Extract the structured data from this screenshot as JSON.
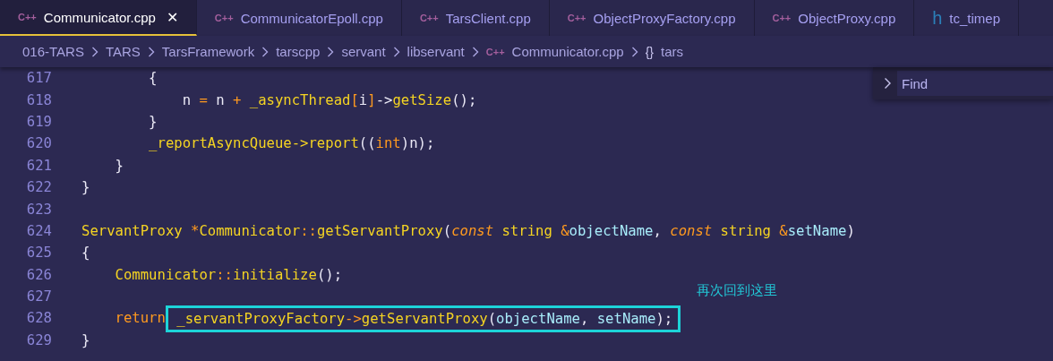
{
  "tabs": [
    {
      "icon": "C++",
      "kind": "cpp",
      "label": "Communicator.cpp",
      "selected": true,
      "closable": true
    },
    {
      "icon": "C++",
      "kind": "cpp",
      "label": "CommunicatorEpoll.cpp",
      "selected": false,
      "closable": false
    },
    {
      "icon": "C++",
      "kind": "cpp",
      "label": "TarsClient.cpp",
      "selected": false,
      "closable": false
    },
    {
      "icon": "C++",
      "kind": "cpp",
      "label": "ObjectProxyFactory.cpp",
      "selected": false,
      "closable": false
    },
    {
      "icon": "C++",
      "kind": "cpp",
      "label": "ObjectProxy.cpp",
      "selected": false,
      "closable": false
    },
    {
      "icon": "h",
      "kind": "header",
      "label": "tc_timep",
      "selected": false,
      "closable": false
    }
  ],
  "close_glyph": "✕",
  "breadcrumb": [
    {
      "label": "016-TARS"
    },
    {
      "label": "TARS"
    },
    {
      "label": "TarsFramework"
    },
    {
      "label": "tarscpp"
    },
    {
      "label": "servant"
    },
    {
      "label": "libservant"
    },
    {
      "label": "Communicator.cpp",
      "icon": "C++",
      "kind": "cpp"
    },
    {
      "label": "tars",
      "icon": "{}",
      "kind": "namespace"
    }
  ],
  "find": {
    "placeholder": "Find"
  },
  "code": [
    {
      "num": "617",
      "tokens": [
        {
          "t": "        {",
          "kind": "plain"
        }
      ]
    },
    {
      "num": "618",
      "tokens": [
        {
          "t": "            n ",
          "kind": "plain"
        },
        {
          "t": "=",
          "kind": "op"
        },
        {
          "t": " n ",
          "kind": "plain"
        },
        {
          "t": "+",
          "kind": "op"
        },
        {
          "t": " _asyncThread",
          "kind": "name"
        },
        {
          "t": "[",
          "kind": "op"
        },
        {
          "t": "i",
          "kind": "plain"
        },
        {
          "t": "]",
          "kind": "op"
        },
        {
          "t": "->",
          "kind": "plain"
        },
        {
          "t": "getSize",
          "kind": "name"
        },
        {
          "t": "();",
          "kind": "plain"
        }
      ]
    },
    {
      "num": "619",
      "tokens": [
        {
          "t": "        }",
          "kind": "plain"
        }
      ]
    },
    {
      "num": "620",
      "tokens": [
        {
          "t": "        _reportAsyncQueue->report",
          "kind": "name"
        },
        {
          "t": "((",
          "kind": "plain"
        },
        {
          "t": "int",
          "kind": "op"
        },
        {
          "t": ")n);",
          "kind": "plain"
        }
      ]
    },
    {
      "num": "621",
      "tokens": [
        {
          "t": "    }",
          "kind": "plain"
        }
      ]
    },
    {
      "num": "622",
      "tokens": [
        {
          "t": "}",
          "kind": "plain"
        }
      ]
    },
    {
      "num": "623"
    },
    {
      "num": "624",
      "tokens": [
        {
          "t": "ServantProxy ",
          "kind": "name"
        },
        {
          "t": "*",
          "kind": "op"
        },
        {
          "t": "Communicator",
          "kind": "name"
        },
        {
          "t": "::",
          "kind": "op"
        },
        {
          "t": "getServantProxy",
          "kind": "name"
        },
        {
          "t": "(",
          "kind": "plain"
        },
        {
          "t": "const",
          "kind": "italic"
        },
        {
          "t": " string ",
          "kind": "name"
        },
        {
          "t": "&",
          "kind": "op"
        },
        {
          "t": "objectName",
          "kind": "param"
        },
        {
          "t": ", ",
          "kind": "plain"
        },
        {
          "t": "const",
          "kind": "italic"
        },
        {
          "t": " string ",
          "kind": "name"
        },
        {
          "t": "&",
          "kind": "op"
        },
        {
          "t": "setName",
          "kind": "param"
        },
        {
          "t": ")",
          "kind": "plain"
        }
      ]
    },
    {
      "num": "625",
      "tokens": [
        {
          "t": "{",
          "kind": "plain"
        }
      ]
    },
    {
      "num": "626",
      "tokens": [
        {
          "t": "    Communicator",
          "kind": "name"
        },
        {
          "t": "::",
          "kind": "op"
        },
        {
          "t": "initialize",
          "kind": "name"
        },
        {
          "t": "();",
          "kind": "plain"
        }
      ]
    },
    {
      "num": "627"
    },
    {
      "num": "628",
      "tokens": [
        {
          "t": "    return",
          "kind": "op"
        }
      ],
      "boxed": [
        {
          "t": " _servantProxyFactory",
          "kind": "name"
        },
        {
          "t": "->",
          "kind": "op"
        },
        {
          "t": "getServantProxy",
          "kind": "name"
        },
        {
          "t": "(",
          "kind": "plain"
        },
        {
          "t": "objectName",
          "kind": "param"
        },
        {
          "t": ", ",
          "kind": "plain"
        },
        {
          "t": "setName",
          "kind": "param"
        },
        {
          "t": ");",
          "kind": "plain"
        }
      ]
    },
    {
      "num": "629",
      "tokens": [
        {
          "t": "}",
          "kind": "plain"
        }
      ]
    }
  ],
  "annotation": {
    "text": "再次回到这里"
  }
}
